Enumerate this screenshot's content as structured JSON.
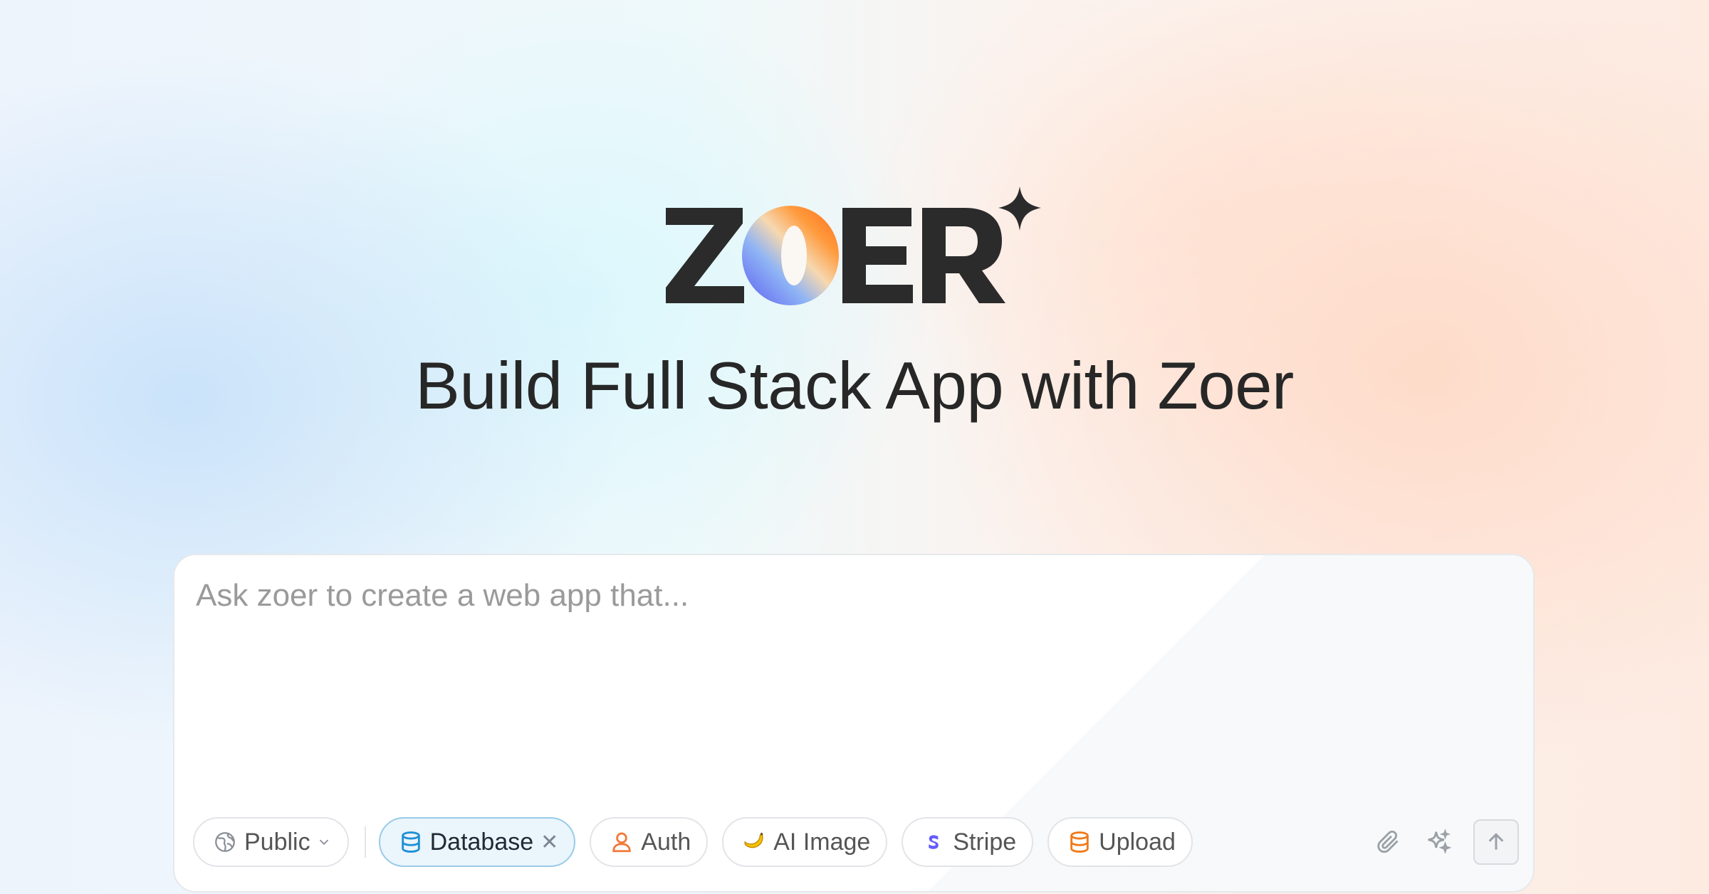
{
  "brand": {
    "logo_text": "ZOER"
  },
  "headline": "Build Full Stack App with Zoer",
  "prompt": {
    "placeholder": "Ask zoer to create a web app that...",
    "value": ""
  },
  "visibility": {
    "label": "Public",
    "icon": "globe-icon"
  },
  "chips": [
    {
      "label": "Database",
      "icon": "database-icon",
      "active": true,
      "color": "#1e8fd6"
    },
    {
      "label": "Auth",
      "icon": "user-icon",
      "active": false,
      "color": "#f07a3a"
    },
    {
      "label": "AI Image",
      "icon": "banana-icon",
      "active": false,
      "color": "#f5b800"
    },
    {
      "label": "Stripe",
      "icon": "stripe-icon",
      "active": false,
      "color": "#635bff"
    },
    {
      "label": "Upload",
      "icon": "stack-icon",
      "active": false,
      "color": "#f07a1a"
    }
  ],
  "colors": {
    "text_primary": "#272727",
    "chip_active_bg": "#eaf5fc",
    "chip_active_border": "#98cbe9"
  }
}
